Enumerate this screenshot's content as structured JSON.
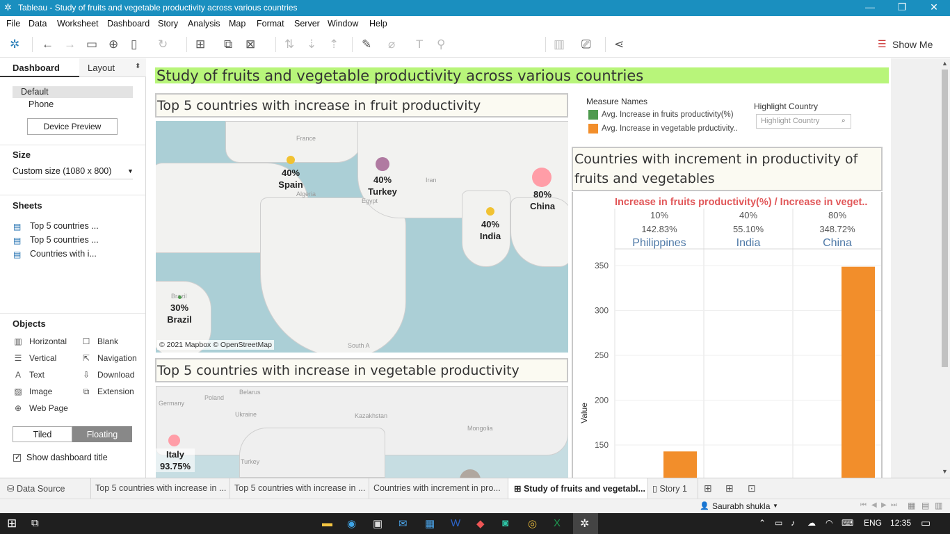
{
  "window": {
    "title": "Tableau - Study of fruits and vegetable productivity across various countries"
  },
  "menu": [
    "File",
    "Data",
    "Worksheet",
    "Dashboard",
    "Story",
    "Analysis",
    "Map",
    "Format",
    "Server",
    "Window",
    "Help"
  ],
  "toolbar": {
    "show_me": "Show Me"
  },
  "left": {
    "tab_dashboard": "Dashboard",
    "tab_layout": "Layout",
    "device_default": "Default",
    "device_phone": "Phone",
    "device_preview": "Device Preview",
    "size_label": "Size",
    "size_value": "Custom size (1080 x 800)",
    "sheets_label": "Sheets",
    "sheets": [
      "Top 5 countries ...",
      "Top 5 countries ...",
      "Countries with i..."
    ],
    "objects_label": "Objects",
    "objects": [
      "Horizontal",
      "Blank",
      "Vertical",
      "Navigation",
      "Text",
      "Download",
      "Image",
      "Extension",
      "Web Page"
    ],
    "tiled": "Tiled",
    "floating": "Floating",
    "show_title": "Show dashboard title"
  },
  "dashboard": {
    "title": "Study of fruits and vegetable productivity across various countries",
    "fruit_title": "Top 5 countries with increase in fruit productivity",
    "veg_title": "Top 5 countries with increase in vegetable productivity",
    "map_credit": "© 2021 Mapbox © OpenStreetMap",
    "fruit_points": [
      {
        "country": "Spain",
        "value": "40%"
      },
      {
        "country": "Turkey",
        "value": "40%"
      },
      {
        "country": "China",
        "value": "80%"
      },
      {
        "country": "India",
        "value": "40%"
      },
      {
        "country": "Brazil",
        "value": "30%"
      }
    ],
    "fruit_map_labels": [
      "France",
      "Algeria",
      "Egypt",
      "Iran",
      "South A",
      "Brazil"
    ],
    "veg_points": [
      {
        "country": "Italy",
        "value": "93.75%"
      }
    ],
    "veg_map_labels": [
      "Poland",
      "Belarus",
      "Germany",
      "Ukraine",
      "Kazakhstan",
      "Mongolia",
      "Turkey"
    ],
    "legend_title": "Measure Names",
    "legend_items": [
      "Avg. Increase in fruits productivity(%)",
      "Avg. Increase in vegetable prductivity.."
    ],
    "highlight_title": "Highlight Country",
    "highlight_placeholder": "Highlight Country",
    "chart_title": "Countries with increment in productivity of fruits and vegetables",
    "chart_header": "Increase in fruits productivity(%)  /  Increase in veget..",
    "colors": {
      "fruit": "#4e9a4e",
      "veg": "#f28e2b",
      "header": "#e15759",
      "title_bg": "#b8f57a"
    }
  },
  "chart_data": {
    "type": "bar",
    "categories": [
      "Philippines",
      "India",
      "China"
    ],
    "fruit_labels": [
      "10%",
      "40%",
      "80%"
    ],
    "veg_labels": [
      "142.83%",
      "55.10%",
      "348.72%"
    ],
    "series": [
      {
        "name": "Avg. Increase in fruits productivity(%)",
        "values": [
          10,
          40,
          80
        ]
      },
      {
        "name": "Avg. Increase in vegetable prductivity..",
        "values": [
          142.83,
          55.1,
          348.72
        ]
      }
    ],
    "ylabel": "Value",
    "yticks": [
      350,
      300,
      250,
      200,
      150
    ],
    "ylim": [
      120,
      360
    ]
  },
  "tabs": [
    "Data Source",
    "Top 5 countries with increase in ...",
    "Top 5 countries with increase in ...",
    "Countries with increment in pro...",
    "Study of fruits and vegetabl...",
    "Story 1"
  ],
  "status": {
    "user": "Saurabh shukla"
  },
  "taskbar": {
    "lang": "ENG",
    "time": "12:35"
  }
}
